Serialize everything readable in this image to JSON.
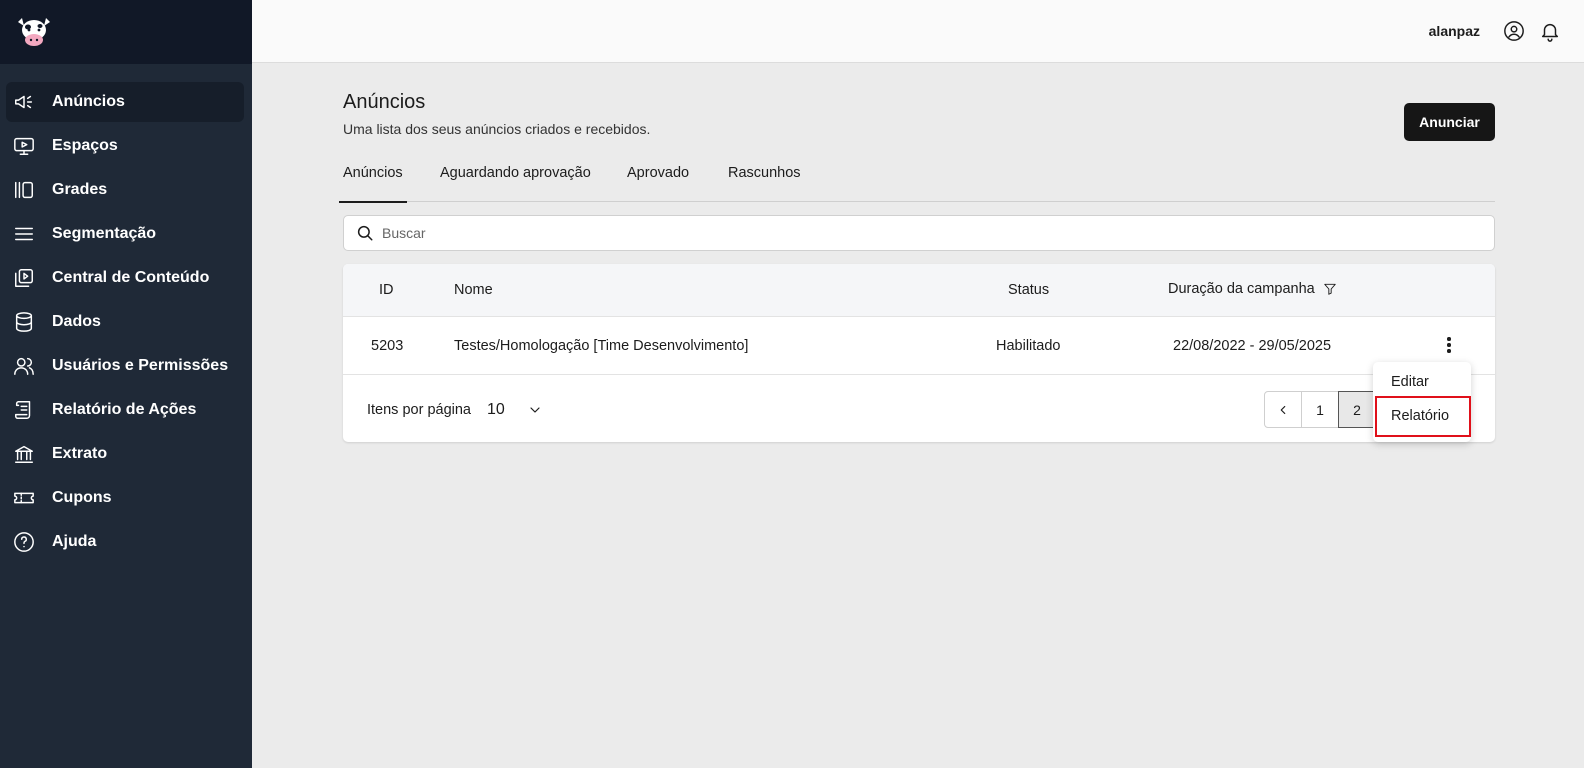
{
  "app": {
    "logo_icon": "cow-logo-icon"
  },
  "header": {
    "username": "alanpaz",
    "account_icon": "user-circle-icon",
    "notification_icon": "bell-icon"
  },
  "sidebar": {
    "items": [
      {
        "label": "Anúncios",
        "icon": "megaphone-icon",
        "active": true
      },
      {
        "label": "Espaços",
        "icon": "monitor-play-icon",
        "active": false
      },
      {
        "label": "Grades",
        "icon": "columns-icon",
        "active": false
      },
      {
        "label": "Segmentação",
        "icon": "menu-lines-icon",
        "active": false
      },
      {
        "label": "Central de Conteúdo",
        "icon": "media-library-icon",
        "active": false
      },
      {
        "label": "Dados",
        "icon": "database-icon",
        "active": false
      },
      {
        "label": "Usuários e Permissões",
        "icon": "users-icon",
        "active": false
      },
      {
        "label": "Relatório de Ações",
        "icon": "scroll-report-icon",
        "active": false
      },
      {
        "label": "Extrato",
        "icon": "bank-icon",
        "active": false
      },
      {
        "label": "Cupons",
        "icon": "ticket-icon",
        "active": false
      },
      {
        "label": "Ajuda",
        "icon": "help-circle-icon",
        "active": false
      }
    ]
  },
  "main": {
    "title": "Anúncios",
    "subtitle": "Uma lista dos seus anúncios criados e recebidos.",
    "primary_button": "Anunciar",
    "tabs": [
      {
        "label": "Anúncios",
        "active": true
      },
      {
        "label": "Aguardando aprovação",
        "active": false
      },
      {
        "label": "Aprovado",
        "active": false
      },
      {
        "label": "Rascunhos",
        "active": false
      }
    ],
    "search": {
      "placeholder": "Buscar",
      "value": ""
    },
    "table": {
      "columns": {
        "id": "ID",
        "name": "Nome",
        "status": "Status",
        "duration": "Duração da campanha"
      },
      "rows": [
        {
          "id": "5203",
          "name": "Testes/Homologação [Time Desenvolvimento]",
          "status": "Habilitado",
          "duration": "22/08/2022 - 29/05/2025"
        }
      ]
    },
    "footer": {
      "per_page_label": "Itens por página",
      "per_page_value": "10",
      "pages": [
        "1",
        "2"
      ],
      "current_page": "2"
    },
    "row_menu": {
      "items": [
        {
          "label": "Editar"
        },
        {
          "label": "Relatório",
          "highlighted": true
        }
      ]
    }
  },
  "colors": {
    "sidebar_bg": "#1f2937",
    "sidebar_top_bg": "#111827",
    "primary_button_bg": "#161616",
    "highlight_border": "#e0101a",
    "page_bg": "#ebebeb"
  }
}
